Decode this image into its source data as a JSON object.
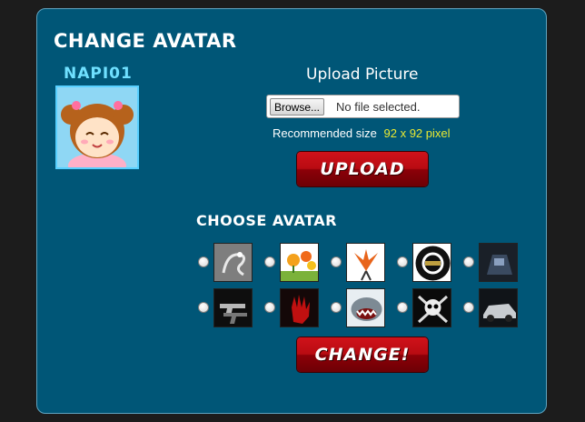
{
  "panel": {
    "title": "CHANGE AVATAR"
  },
  "profile": {
    "username": "NAPI01",
    "avatar_icon": "cartoon-girl-face-icon"
  },
  "upload": {
    "heading": "Upload Picture",
    "browse_label": "Browse...",
    "file_status": "No file selected.",
    "recommended_label": "Recommended size",
    "recommended_value": "92 x 92 pixel",
    "button_label": "UPLOAD"
  },
  "choose": {
    "heading": "CHOOSE AVATAR",
    "options": [
      "dragon-icon",
      "flowers-icon",
      "phoenix-icon",
      "poker-chip-icon",
      "robot-car-icon",
      "guns-icon",
      "bloody-hand-icon",
      "shark-icon",
      "pirate-skull-icon",
      "sports-car-icon"
    ],
    "button_label": "CHANGE!"
  },
  "colors": {
    "panel": "#005677",
    "accent": "#6fe0ff",
    "button_red": "#b80b12",
    "highlight": "#e8e832"
  }
}
